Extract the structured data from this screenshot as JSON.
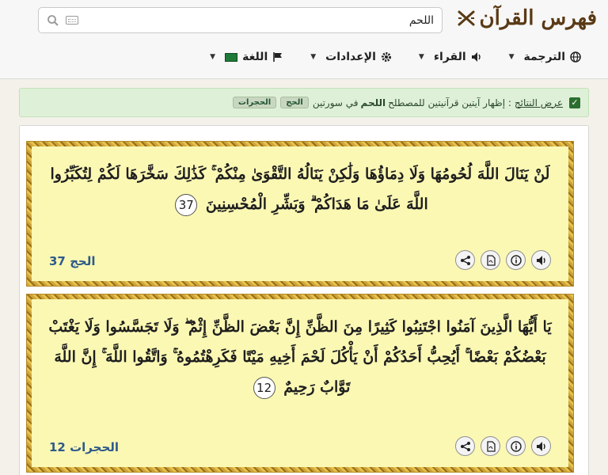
{
  "header": {
    "logo_text": "فهرس القرآن",
    "search": {
      "value": "اللحم",
      "placeholder": ""
    },
    "nav": [
      {
        "label": "الترجمة"
      },
      {
        "label": "القراء"
      },
      {
        "label": "الإعدادات"
      },
      {
        "label": "اللغة"
      }
    ]
  },
  "alert": {
    "link_text": "عرض النتائج",
    "sep": ":",
    "text_before": "إظهار آيتين قرآنيتين للمصطلح",
    "term": "اللحم",
    "text_after": "في سورتين",
    "badges": [
      "الحج",
      "الحجرات"
    ]
  },
  "verses": [
    {
      "text": "لَنْ يَنَالَ اللَّهَ لُحُومُهَا وَلَا دِمَاؤُهَا وَلَٰكِنْ يَنَالُهُ التَّقْوَىٰ مِنْكُمْ ۚ كَذَٰلِكَ سَخَّرَهَا لَكُمْ لِتُكَبِّرُوا اللَّهَ عَلَىٰ مَا هَدَاكُمْ ۗ وَبَشِّرِ الْمُحْسِنِينَ",
      "number": "37",
      "reference": "الحج 37"
    },
    {
      "text": "يَا أَيُّهَا الَّذِينَ آمَنُوا اجْتَنِبُوا كَثِيرًا مِنَ الظَّنِّ إِنَّ بَعْضَ الظَّنِّ إِثْمٌ ۖ وَلَا تَجَسَّسُوا وَلَا يَغْتَبْ بَعْضُكُمْ بَعْضًا ۚ أَيُحِبُّ أَحَدُكُمْ أَنْ يَأْكُلَ لَحْمَ أَخِيهِ مَيْتًا فَكَرِهْتُمُوهُ ۚ وَاتَّقُوا اللَّهَ ۚ إِنَّ اللَّهَ تَوَّابٌ رَحِيمٌ",
      "number": "12",
      "reference": "الحجرات 12"
    }
  ],
  "colors": {
    "accent": "#2e5a8a",
    "verse_bg": "#fbf8b4",
    "logo": "#5a3a16",
    "alert_bg": "#dff0d8"
  },
  "icons": [
    "audio-icon",
    "info-icon",
    "pdf-icon",
    "share-icon"
  ]
}
